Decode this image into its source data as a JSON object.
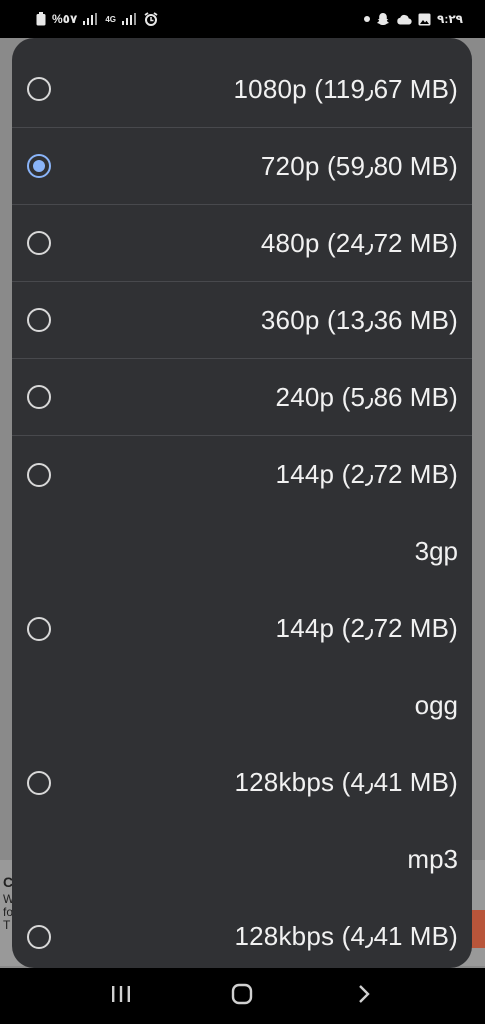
{
  "status_bar": {
    "battery_text": "%٥٧",
    "network_label": "4G",
    "time": "٩:٢٩"
  },
  "background_app": {
    "lines": [
      "W",
      "fo",
      "T"
    ],
    "heading_fragment": "C"
  },
  "dialog": {
    "items": [
      {
        "type": "option",
        "label": "1080p (119٫67 MB)",
        "selected": false,
        "divided": true
      },
      {
        "type": "option",
        "label": "720p (59٫80 MB)",
        "selected": true,
        "divided": true
      },
      {
        "type": "option",
        "label": "480p (24٫72 MB)",
        "selected": false,
        "divided": true
      },
      {
        "type": "option",
        "label": "360p (13٫36 MB)",
        "selected": false,
        "divided": true
      },
      {
        "type": "option",
        "label": "240p (5٫86 MB)",
        "selected": false,
        "divided": true
      },
      {
        "type": "option",
        "label": "144p (2٫72 MB)",
        "selected": false,
        "divided": false
      },
      {
        "type": "header",
        "label": "3gp"
      },
      {
        "type": "option",
        "label": "144p (2٫72 MB)",
        "selected": false,
        "divided": false
      },
      {
        "type": "header",
        "label": "ogg"
      },
      {
        "type": "option",
        "label": "128kbps (4٫41 MB)",
        "selected": false,
        "divided": false
      },
      {
        "type": "header",
        "label": "mp3"
      },
      {
        "type": "option",
        "label": "128kbps (4٫41 MB)",
        "selected": false,
        "divided": false
      }
    ]
  },
  "nav_bar": {
    "icons": [
      "recents-icon",
      "home-icon",
      "back-icon"
    ]
  },
  "colors": {
    "dialog_bg": "#303134",
    "accent": "#8ab4f8",
    "text": "#f1f1f1"
  }
}
